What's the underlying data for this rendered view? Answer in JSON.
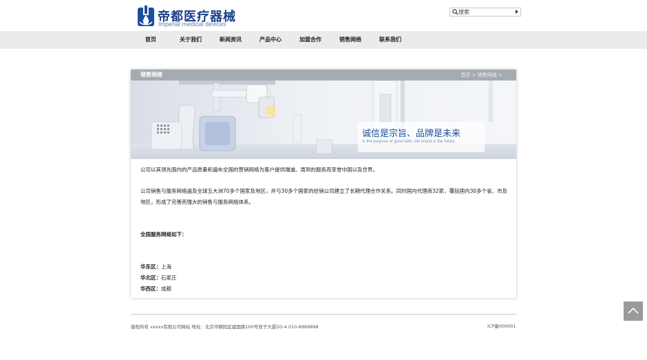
{
  "brand": {
    "title": "帝都医疗器械",
    "subtitle": "Imperial medical devices",
    "accent": "#1c3f8a"
  },
  "search": {
    "placeholder": "搜索",
    "icon": "search-icon"
  },
  "nav": {
    "items": [
      {
        "label": "首页"
      },
      {
        "label": "关于我们"
      },
      {
        "label": "新闻资讯"
      },
      {
        "label": "产品中心"
      },
      {
        "label": "加盟合作"
      },
      {
        "label": "销售网络"
      },
      {
        "label": "联系我们"
      }
    ]
  },
  "page": {
    "title": "销售网络",
    "breadcrumb": {
      "home": "首页",
      "sep": ">",
      "current": "销售网络",
      "trail": ">"
    }
  },
  "banner": {
    "slogan": "诚信是宗旨、品牌是未来",
    "subline": "Is the purpose of good faith, the brand is the future"
  },
  "content": {
    "p1": "公司以其领先国内的产品质量和遍布全国的营销网络为客户提供瑞诚、周到的服务而享誉中国以及世界。",
    "p2": "公司销售与服务网络遍及全球五大洲70多个国家及地区，并与30多个国家的经销公司建立了长期代理合作关系。同时国内代理商32家，覆括国内30多个省、市及地区，形成了完善而强大的销售与服务网络体系。",
    "heading": "全国服务网络如下：",
    "regions": [
      {
        "name": "华东区：",
        "city": "上海"
      },
      {
        "name": "华北区：",
        "city": "石家庄"
      },
      {
        "name": "华西区：",
        "city": "成都"
      }
    ]
  },
  "footer": {
    "copyright": "版权所有 xxxxx有限公司网站 地址：北京市朝阳区建国路100号双子大厦D3-4 010-8989898",
    "icp": "ICP备000001"
  },
  "back_to_top": {
    "icon": "chevron-up-icon",
    "color": "#9a9a9a"
  }
}
